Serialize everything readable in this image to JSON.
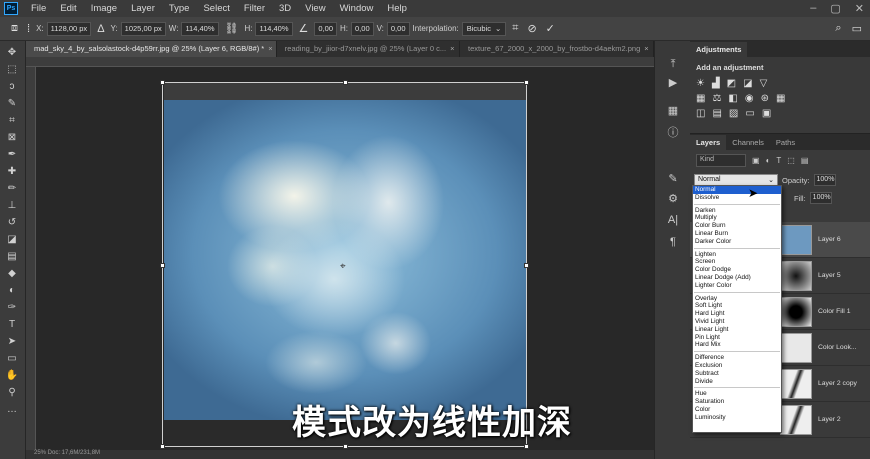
{
  "menubar": {
    "logo": "Ps",
    "items": [
      "File",
      "Edit",
      "Image",
      "Layer",
      "Type",
      "Select",
      "Filter",
      "3D",
      "View",
      "Window",
      "Help"
    ]
  },
  "options": {
    "x_label": "X:",
    "x_value": "1128,00 px",
    "y_label": "Y:",
    "y_value": "1025,00 px",
    "w_label": "W:",
    "w_value": "114,40%",
    "h_label": "H:",
    "h_value": "114,40%",
    "angle_value": "0,00",
    "hskew_label": "H:",
    "hskew_value": "0,00",
    "vskew_label": "V:",
    "vskew_value": "0,00",
    "interp_label": "Interpolation:",
    "interp_value": "Bicubic"
  },
  "tabs": [
    {
      "label": "mad_sky_4_by_salsolastock-d4p59rr.jpg @ 25% (Layer 6, RGB/8#) *"
    },
    {
      "label": "reading_by_jiior-d7xnelv.jpg @ 25% (Layer 0 c..."
    },
    {
      "label": "texture_67_2000_x_2000_by_frostbo-d4aekm2.png"
    }
  ],
  "subtitle": "模式改为线性加深",
  "status": "25%   Doc: 17,6M/231,8M",
  "adjustments": {
    "tab": "Adjustments",
    "title": "Add an adjustment"
  },
  "layers": {
    "tabs": [
      "Layers",
      "Channels",
      "Paths"
    ],
    "kind_placeholder": "Kind",
    "blend_mode": "Normal",
    "opacity_label": "Opacity:",
    "opacity_value": "100%",
    "fill_label": "Fill:",
    "fill_value": "100%",
    "rows": [
      {
        "name": "Layer 6"
      },
      {
        "name": "Layer 5"
      },
      {
        "name": "Color Fill 1"
      },
      {
        "name": "Color Look..."
      },
      {
        "name": "Layer 2 copy"
      },
      {
        "name": "Layer 2"
      }
    ]
  },
  "blend_modes": {
    "group1": [
      "Normal",
      "Dissolve"
    ],
    "group2": [
      "Darken",
      "Multiply",
      "Color Burn",
      "Linear Burn",
      "Darker Color"
    ],
    "group3": [
      "Lighten",
      "Screen",
      "Color Dodge",
      "Linear Dodge (Add)",
      "Lighter Color"
    ],
    "group4": [
      "Overlay",
      "Soft Light",
      "Hard Light",
      "Vivid Light",
      "Linear Light",
      "Pin Light",
      "Hard Mix"
    ],
    "group5": [
      "Difference",
      "Exclusion",
      "Subtract",
      "Divide"
    ],
    "group6": [
      "Hue",
      "Saturation",
      "Color",
      "Luminosity"
    ]
  },
  "colors": {
    "foreground": "#c6cf58",
    "selection": "#1e5fcf"
  }
}
